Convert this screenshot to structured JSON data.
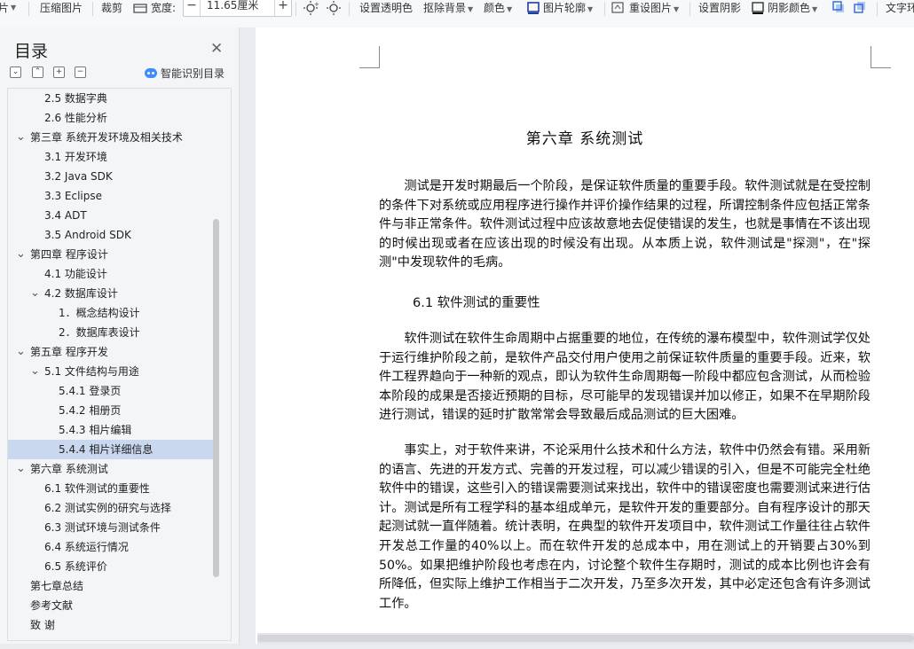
{
  "toolbar": {
    "items": [
      "片",
      "压缩图片",
      "裁剪",
      "宽度:",
      "11.65厘米",
      "设置透明色",
      "抠除背景",
      "颜色",
      "图片轮廓",
      "重设图片",
      "设置阴影",
      "阴影颜色",
      "文字环"
    ],
    "width_label": "宽度:",
    "width_value": "11.65厘米",
    "minus": "−",
    "plus": "+"
  },
  "sidebar": {
    "title": "目录",
    "smart_label": "智能识别目录",
    "ctrl_icons": [
      "collapse-icon",
      "expand-up-icon",
      "add-icon",
      "remove-icon"
    ],
    "toc": [
      {
        "label": "2.5 数据字典",
        "level": 2,
        "caret": ""
      },
      {
        "label": "2.6 性能分析",
        "level": 2,
        "caret": ""
      },
      {
        "label": "第三章  系统开发环境及相关技术",
        "level": 1,
        "caret": "v"
      },
      {
        "label": "3.1 开发环境",
        "level": 2,
        "caret": ""
      },
      {
        "label": "3.2 Java SDK",
        "level": 2,
        "caret": ""
      },
      {
        "label": "3.3 Eclipse",
        "level": 2,
        "caret": ""
      },
      {
        "label": "3.4 ADT",
        "level": 2,
        "caret": ""
      },
      {
        "label": "3.5 Android SDK",
        "level": 2,
        "caret": ""
      },
      {
        "label": "第四章  程序设计",
        "level": 1,
        "caret": "v"
      },
      {
        "label": "4.1    功能设计",
        "level": 2,
        "caret": ""
      },
      {
        "label": "4.2    数据库设计",
        "level": 2,
        "caret": "v"
      },
      {
        "label": "1．概念结构设计",
        "level": 3,
        "caret": ""
      },
      {
        "label": "2．数据库表设计",
        "level": 3,
        "caret": ""
      },
      {
        "label": "第五章  程序开发",
        "level": 1,
        "caret": "v"
      },
      {
        "label": "5.1    文件结构与用途",
        "level": 2,
        "caret": "v"
      },
      {
        "label": "5.4.1 登录页",
        "level": 3,
        "caret": ""
      },
      {
        "label": "5.4.2 相册页",
        "level": 3,
        "caret": ""
      },
      {
        "label": "5.4.3 相片编辑",
        "level": 3,
        "caret": ""
      },
      {
        "label": "5.4.4 相片详细信息",
        "level": 3,
        "caret": "",
        "selected": true
      },
      {
        "label": "第六章    系统测试",
        "level": 1,
        "caret": "v"
      },
      {
        "label": "6.1    软件测试的重要性",
        "level": 2,
        "caret": ""
      },
      {
        "label": "6.2    测试实例的研究与选择",
        "level": 2,
        "caret": ""
      },
      {
        "label": "6.3    测试环境与测试条件",
        "level": 2,
        "caret": ""
      },
      {
        "label": "6.4    系统运行情况",
        "level": 2,
        "caret": ""
      },
      {
        "label": "6.5    系统评价",
        "level": 2,
        "caret": ""
      },
      {
        "label": "第七章总结",
        "level": 1,
        "caret": ""
      },
      {
        "label": "参考文献",
        "level": 1,
        "caret": ""
      },
      {
        "label": "致    谢",
        "level": 1,
        "caret": ""
      }
    ]
  },
  "document": {
    "chapter_title": "第六章    系统测试",
    "intro": "测试是开发时期最后一个阶段，是保证软件质量的重要手段。软件测试就是在受控制的条件下对系统或应用程序进行操作并评价操作结果的过程，所谓控制条件应包括正常条件与非正常条件。软件测试过程中应该故意地去促使错误的发生，也就是事情在不该出现的时候出现或者在应该出现的时候没有出现。从本质上说，软件测试是\"探测\"，在\"探测\"中发现软件的毛病。",
    "section_title": "6.1    软件测试的重要性",
    "para1": "软件测试在软件生命周期中占据重要的地位，在传统的瀑布模型中，软件测试学仅处于运行维护阶段之前，是软件产品交付用户使用之前保证软件质量的重要手段。近来，软件工程界趋向于一种新的观点，即认为软件生命周期每一阶段中都应包含测试，从而检验本阶段的成果是否接近预期的目标，尽可能早的发现错误并加以修正，如果不在早期阶段进行测试，错误的延时扩散常常会导致最后成品测试的巨大困难。",
    "para2": "事实上，对于软件来讲，不论采用什么技术和什么方法，软件中仍然会有错。采用新的语言、先进的开发方式、完善的开发过程，可以减少错误的引入，但是不可能完全杜绝软件中的错误，这些引入的错误需要测试来找出，软件中的错误密度也需要测试来进行估计。测试是所有工程学科的基本组成单元，是软件开发的重要部分。自有程序设计的那天起测试就一直伴随着。统计表明，在典型的软件开发项目中，软件测试工作量往往占软件开发总工作量的40%以上。而在软件开发的总成本中，用在测试上的开销要占30%到50%。如果把维护阶段也考虑在内，讨论整个软件生存期时，测试的成本比例也许会有所降低，但实际上维护工作相当于二次开发，乃至多次开发，其中必定还包含有许多测试工作。",
    "next_heading_partial": "6.2    测试实例的研究与选择"
  }
}
